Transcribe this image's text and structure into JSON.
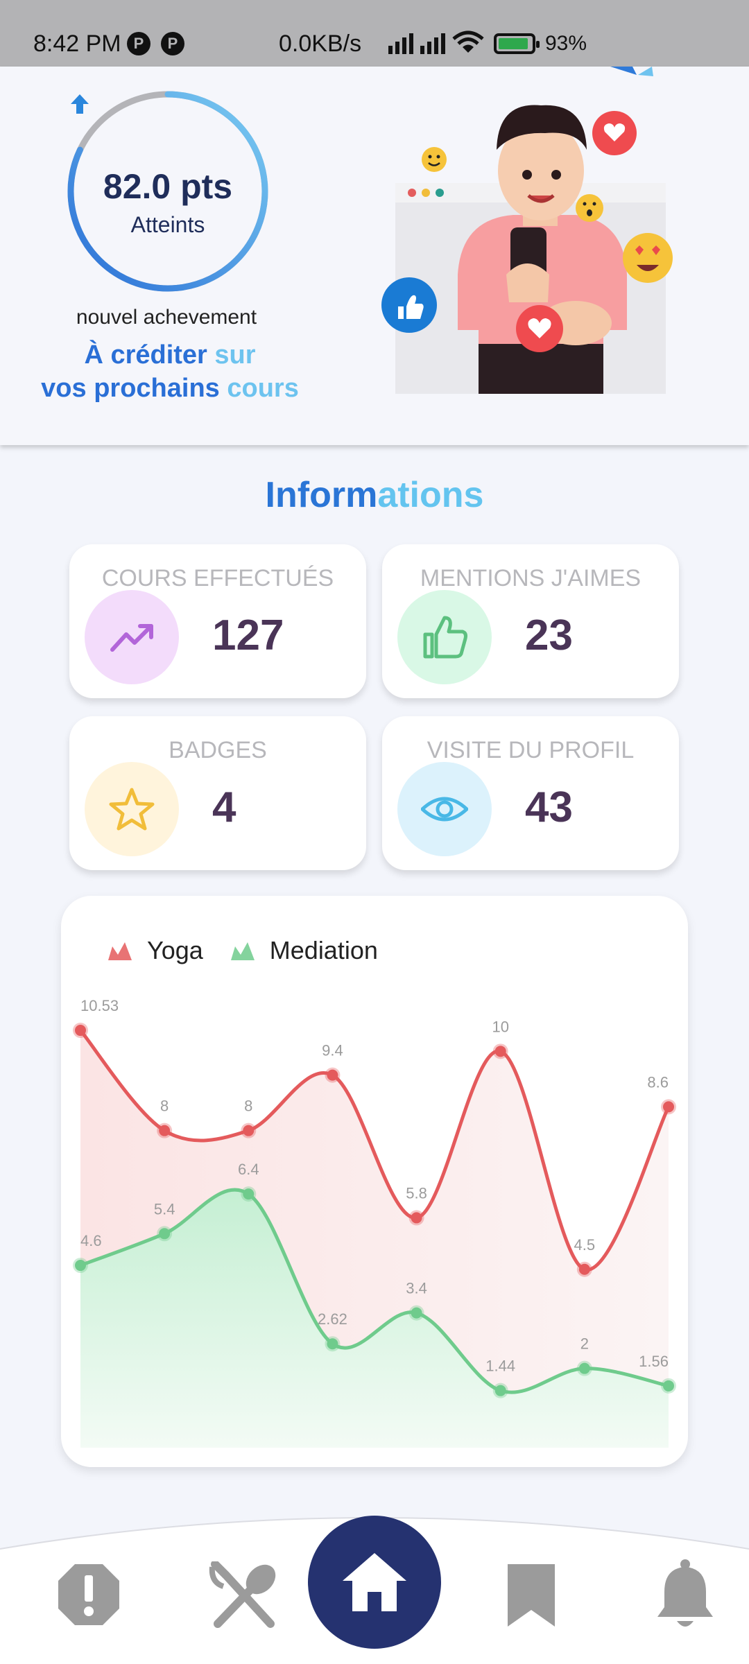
{
  "status_bar": {
    "time": "8:42 PM",
    "speed": "0.0KB/s",
    "battery": "93%",
    "notif_glyph": "P"
  },
  "achievement": {
    "points": "82.0 pts",
    "reached": "Atteints",
    "progress": 0.82,
    "new_achievement": "nouvel achevement",
    "credit_line1_part1": "À créditer",
    "credit_line1_part2": " sur",
    "credit_line2_part1": "vos prochains",
    "credit_line2_part2": " cours"
  },
  "info": {
    "title_part1": "Inform",
    "title_part2": "ations",
    "cards": [
      {
        "label": "COURS EFFECTUÉS",
        "value": "127",
        "icon": "trending-up-icon",
        "bg": "#f3dcfb",
        "color": "#b265d9"
      },
      {
        "label": "MENTIONS J'AIMES",
        "value": "23",
        "icon": "thumbs-up-icon",
        "bg": "#d9f8e6",
        "color": "#5cc07f"
      },
      {
        "label": "BADGES",
        "value": "4",
        "icon": "star-icon",
        "bg": "#fff4dc",
        "color": "#f1bd3a"
      },
      {
        "label": "VISITE DU PROFIL",
        "value": "43",
        "icon": "eye-icon",
        "bg": "#dcf2fc",
        "color": "#49b8e6"
      }
    ]
  },
  "chart_data": {
    "type": "area",
    "x": [
      1,
      2,
      3,
      4,
      5,
      6,
      7,
      8
    ],
    "series": [
      {
        "name": "Yoga",
        "values": [
          10.53,
          8,
          8,
          9.4,
          5.8,
          10,
          4.5,
          8.6
        ],
        "color": "#e45a5c"
      },
      {
        "name": "Mediation",
        "values": [
          4.6,
          5.4,
          6.4,
          2.62,
          3.4,
          1.44,
          2,
          1.56
        ],
        "color": "#6fcb8c"
      }
    ],
    "data_labels": true,
    "legend": "top-left"
  },
  "nav": {
    "items": [
      "alert-icon",
      "food-icon",
      "home-icon",
      "bookmark-icon",
      "bell-icon"
    ],
    "active": "home-icon",
    "active_color": "#253270"
  }
}
